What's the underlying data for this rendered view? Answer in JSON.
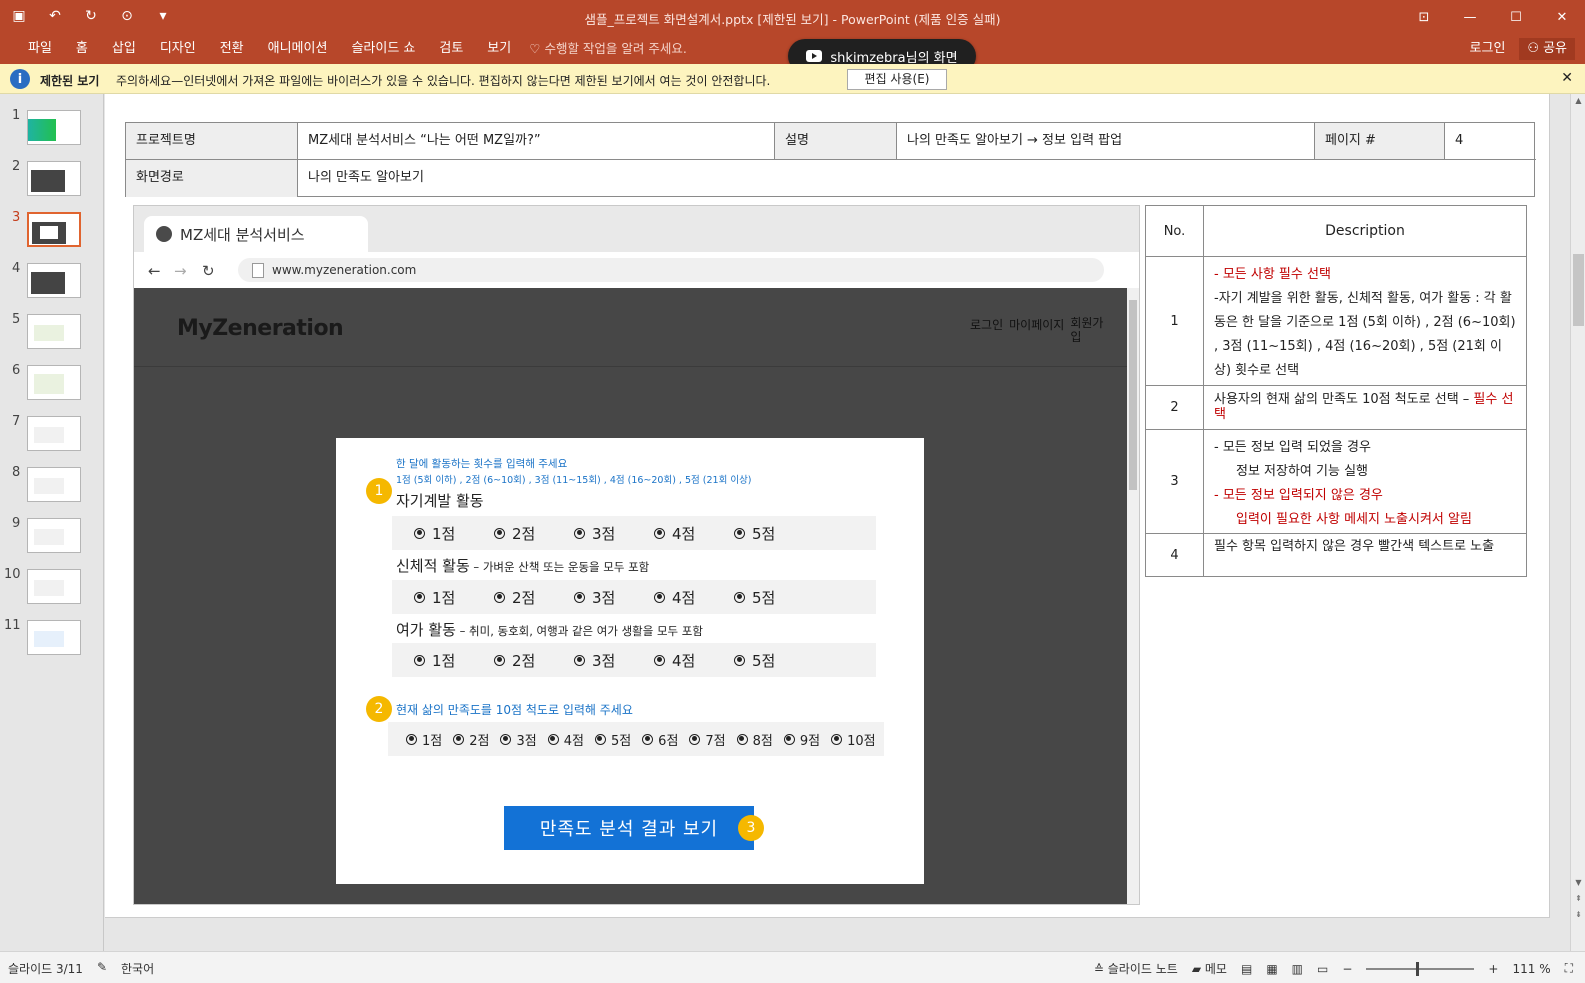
{
  "app": {
    "title": "샘플_프로젝트 화면설계서.pptx [제한된 보기] - PowerPoint (제품 인증 실패)",
    "tabs": [
      "파일",
      "홈",
      "삽입",
      "디자인",
      "전환",
      "애니메이션",
      "슬라이드 쇼",
      "검토",
      "보기"
    ],
    "tellme": "수행할 작업을 알려 주세요.",
    "login": "로그인",
    "share": "공유",
    "screen_share": "shkimzebra님의 화면"
  },
  "msgbar": {
    "label": "제한된 보기",
    "text": "주의하세요—인터넷에서 가져온 파일에는 바이러스가 있을 수 있습니다. 편집하지 않는다면 제한된 보기에서 여는 것이 안전합니다.",
    "button": "편집 사용(E)"
  },
  "thumbs": [
    "1",
    "2",
    "3",
    "4",
    "5",
    "6",
    "7",
    "8",
    "9",
    "10",
    "11"
  ],
  "header": {
    "k1": "프로젝트명",
    "v1": "MZ세대 분석서비스 “나는 어떤 MZ일까?”",
    "k2": "설명",
    "v2": "나의 만족도 알아보기 → 정보 입력 팝업",
    "k3": "페이지 #",
    "v3": "4",
    "k4": "화면경로",
    "v4": "나의 만족도 알아보기"
  },
  "browser": {
    "tab": "MZ세대 분석서비스",
    "url": "www.myzeneration.com",
    "logo": "MyZeneration",
    "nav": [
      "로그인",
      "마이페이지",
      "회원가입"
    ]
  },
  "popup": {
    "q1_title": "한 달에 활동하는 횟수를 입력해 주세요",
    "q1_scale": "1점 (5회 이하) , 2점 (6~10회) , 3점 (11~15회) , 4점 (16~20회) , 5점 (21회 이상)",
    "sec1": "자기계발 활동",
    "sec2": "신체적 활동",
    "sec2_sub": " – 가벼운 산책 또는 운동을 모두 포함",
    "sec3": "여가 활동",
    "sec3_sub": " – 취미, 동호회, 여행과 같은 여가 생활을 모두 포함",
    "five": [
      "1점",
      "2점",
      "3점",
      "4점",
      "5점"
    ],
    "q2_title": "현재 삶의 만족도를 10점 척도로 입력해 주세요",
    "ten": [
      "1점",
      "2점",
      "3점",
      "4점",
      "5점",
      "6점",
      "7점",
      "8점",
      "9점",
      "10점"
    ],
    "cta": "만족도 분석 결과 보기",
    "badges": [
      "1",
      "2",
      "3"
    ]
  },
  "desc": {
    "h_no": "No.",
    "h_desc": "Description",
    "r1_no": "1",
    "r1_a": "- 모든 사항 필수 선택",
    "r1_b": "-자기 계발을 위한 활동, 신체적 활동, 여가 활동 : 각 활동은 한 달을 기준으로 1점 (5회 이하) , 2점 (6~10회) , 3점 (11~15회) , 4점 (16~20회) , 5점 (21회 이상) 횟수로 선택",
    "r2_no": "2",
    "r2_a": "사용자의 현재 삶의 만족도 10점 척도로 선택 – ",
    "r2_b": "필수 선택",
    "r3_no": "3",
    "r3_a": "-   모든 정보 입력 되었을 경우",
    "r3_b": "정보 저장하여 기능 실행",
    "r3_c": "-   모든 정보 입력되지 않은 경우",
    "r3_d": "입력이 필요한 사항 메세지 노출시켜서 알림",
    "r4_no": "4",
    "r4_a": "필수 항목 입력하지 않은 경우 빨간색 텍스트로 노출"
  },
  "status": {
    "slide": "슬라이드 3/11",
    "lang": "한국어",
    "notes": "슬라이드 노트",
    "memo": "메모",
    "zoom": "111 %"
  },
  "colors": {
    "accent": "#b7472a",
    "badge": "#f5b800",
    "button": "#1372d6",
    "required": "#c00000"
  }
}
